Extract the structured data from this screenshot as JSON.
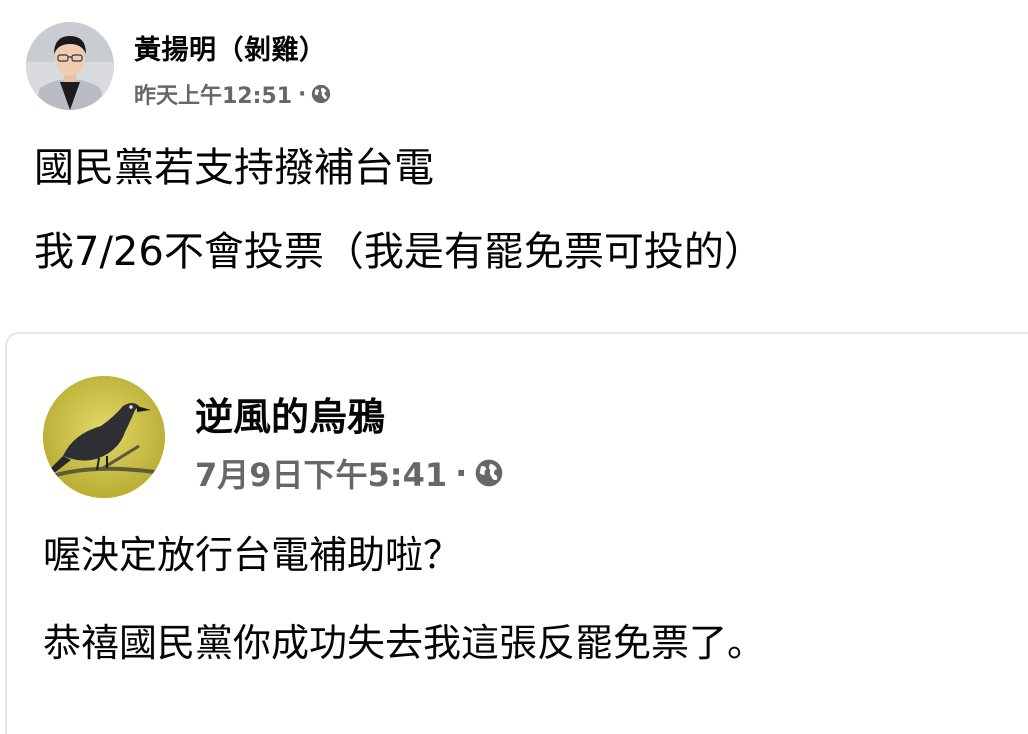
{
  "post": {
    "author": {
      "name": "黃揚明（剝雞）",
      "timestamp": "昨天上午12:51",
      "separator": "·",
      "privacy_icon": "globe-icon"
    },
    "text_lines": [
      "國民黨若支持撥補台電",
      "我7/26不會投票（我是有罷免票可投的）"
    ],
    "shared_post": {
      "author": {
        "name": "逆風的烏鴉",
        "timestamp": "7月9日下午5:41",
        "separator": "·",
        "privacy_icon": "globe-icon"
      },
      "text_lines": [
        "喔決定放行台電補助啦？",
        "恭禧國民黨你成功失去我這張反罷免票了。"
      ]
    }
  },
  "colors": {
    "text": "#050505",
    "secondary_text": "#65676b",
    "divider": "#e4e6eb"
  }
}
